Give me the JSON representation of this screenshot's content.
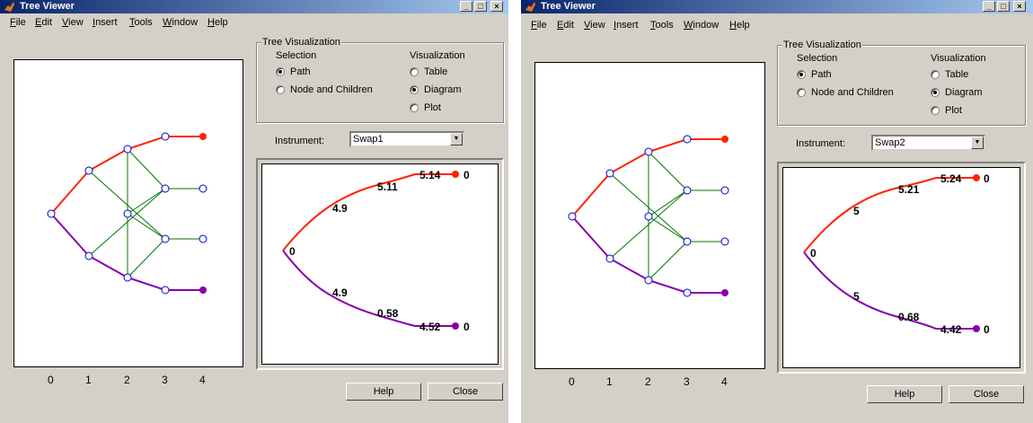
{
  "title_bar": {
    "title": "Tree Viewer",
    "minimize_icon": "minimize-icon",
    "maximize_icon": "maximize-icon",
    "close_icon": "close-icon"
  },
  "menu": [
    {
      "label": "File",
      "ul": "F",
      "rest": "ile"
    },
    {
      "label": "Edit",
      "ul": "E",
      "rest": "dit"
    },
    {
      "label": "View",
      "ul": "V",
      "rest": "iew"
    },
    {
      "label": "Insert",
      "ul": "I",
      "rest": "nsert"
    },
    {
      "label": "Tools",
      "ul": "T",
      "rest": "ools"
    },
    {
      "label": "Window",
      "ul": "W",
      "rest": "indow"
    },
    {
      "label": "Help",
      "ul": "H",
      "rest": "elp"
    }
  ],
  "tree_plot": {
    "x_ticks": [
      "0",
      "1",
      "2",
      "3",
      "4"
    ],
    "colors": {
      "up_path": "#ff2200",
      "down_path": "#8800aa",
      "branches": "#007700",
      "nodes": "#0000dd"
    }
  },
  "panel": {
    "group_title": "Tree Visualization",
    "selection_label": "Selection",
    "selection_options": [
      "Path",
      "Node and Children"
    ],
    "selection_selected": "Path",
    "visualization_label": "Visualization",
    "visualization_options": [
      "Table",
      "Diagram",
      "Plot"
    ],
    "visualization_selected": "Diagram",
    "instrument_label": "Instrument:",
    "help_button": "Help",
    "close_button": "Close",
    "dropdown_icon": "chevron-down-icon"
  },
  "windows": [
    {
      "instrument": "Swap1",
      "up_labels": [
        "0",
        "4.9",
        "5.11",
        "5.14",
        "0"
      ],
      "down_labels": [
        "4.9",
        "0.58",
        "4.52",
        "0"
      ]
    },
    {
      "instrument": "Swap2",
      "up_labels": [
        "0",
        "5",
        "5.21",
        "5.24",
        "0"
      ],
      "down_labels": [
        "5",
        "0.68",
        "4.42",
        "0"
      ]
    }
  ]
}
